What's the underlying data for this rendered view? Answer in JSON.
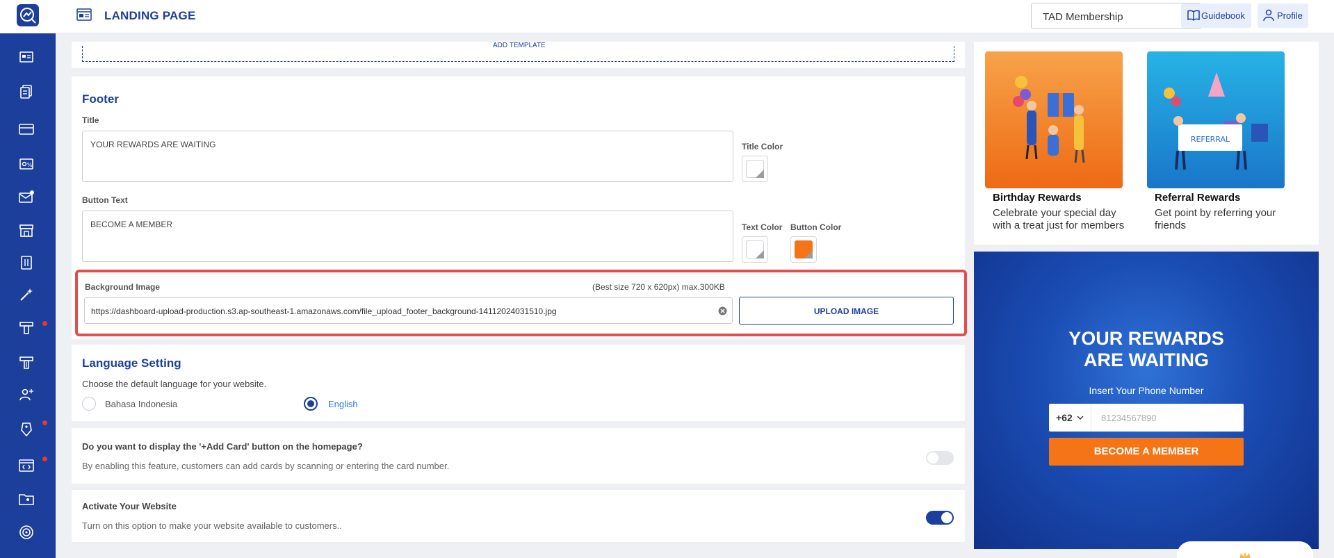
{
  "header": {
    "title": "LANDING PAGE",
    "select_value": "TAD Membership",
    "guidebook": "Guidebook",
    "profile": "Profile"
  },
  "template": {
    "add_label": "ADD TEMPLATE"
  },
  "footer": {
    "heading": "Footer",
    "title_label": "Title",
    "title_value": "YOUR REWARDS ARE WAITING",
    "title_color_label": "Title Color",
    "button_text_label": "Button Text",
    "button_text_value": "BECOME A MEMBER",
    "text_color_label": "Text Color",
    "button_color_label": "Button Color",
    "button_color": "#f47416",
    "bg_image_label": "Background Image",
    "bg_image_hint": "(Best size 720 x 620px) max.300KB",
    "bg_image_url": "https://dashboard-upload-production.s3.ap-southeast-1.amazonaws.com/file_upload_footer_background-14112024031510.jpg",
    "upload_button": "UPLOAD IMAGE"
  },
  "language": {
    "heading": "Language Setting",
    "description": "Choose the default language for your website.",
    "options": [
      "Bahasa Indonesia",
      "English"
    ],
    "selected": "English"
  },
  "add_card": {
    "question": "Do you want to display the '+Add Card' button on the homepage?",
    "description": "By enabling this feature, customers can add cards by scanning or entering the card number.",
    "enabled": false
  },
  "activate": {
    "question": "Activate Your Website",
    "description": "Turn on this option to make your website available to customers..",
    "enabled": true
  },
  "preview": {
    "cards": [
      {
        "title": "Birthday Rewards",
        "description": "Celebrate your special day with a treat just for members"
      },
      {
        "title": "Referral Rewards",
        "description": "Get point by referring your friends"
      }
    ],
    "referral_sign": "REFERRAL",
    "hero_title": "YOUR REWARDS ARE WAITING",
    "hero_sub": "Insert Your Phone Number",
    "country_code": "+62",
    "phone_placeholder": "81234567890",
    "cta": "BECOME A MEMBER"
  },
  "colors": {
    "brand": "#1b3f9a",
    "accent": "#f47416",
    "highlight": "#e24e4e"
  }
}
